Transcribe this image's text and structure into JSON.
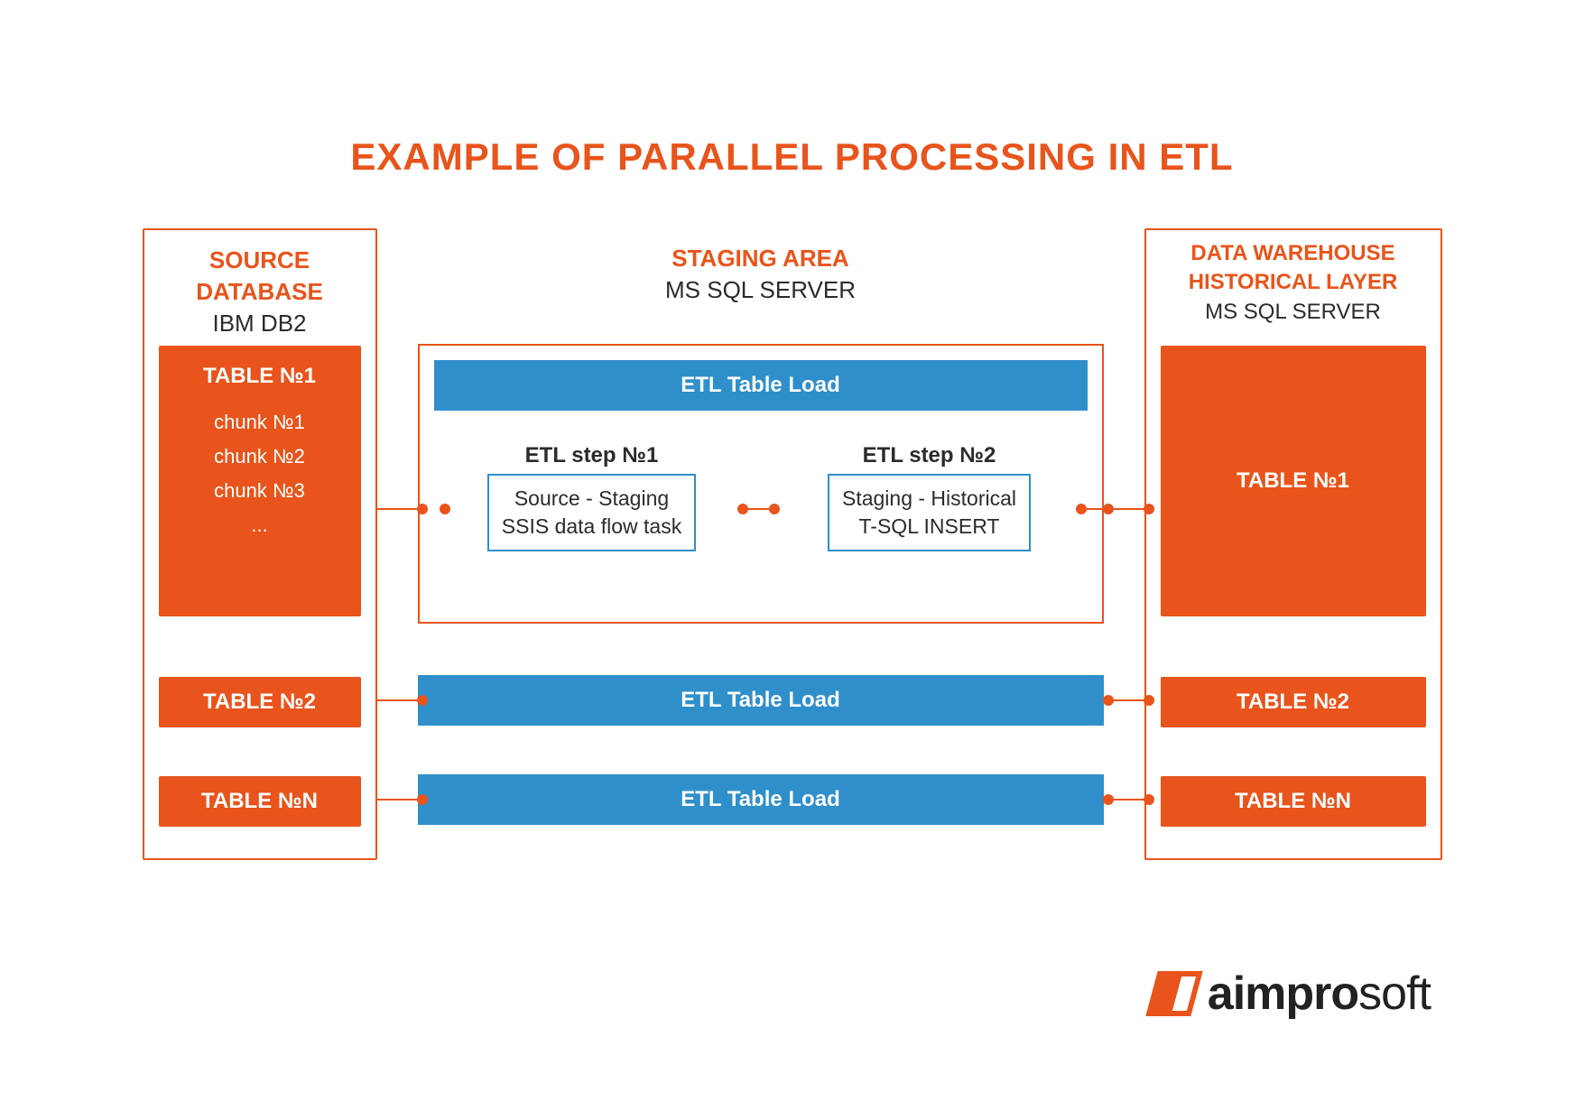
{
  "title": "EXAMPLE OF PARALLEL PROCESSING IN ETL",
  "source": {
    "heading": "SOURCE DATABASE",
    "sub": "IBM DB2",
    "table1": "TABLE №1",
    "chunks": [
      "chunk №1",
      "chunk №2",
      "chunk №3",
      "..."
    ],
    "table2": "TABLE №2",
    "tableN": "TABLE №N"
  },
  "staging": {
    "heading": "STAGING AREA",
    "sub": "MS SQL SERVER",
    "load1": "ETL Table Load",
    "load2": "ETL Table Load",
    "loadN": "ETL Table Load",
    "step1": {
      "title": "ETL step №1",
      "line1": "Source - Staging",
      "line2": "SSIS data flow task"
    },
    "step2": {
      "title": "ETL step №2",
      "line1": "Staging - Historical",
      "line2": "T-SQL INSERT"
    }
  },
  "warehouse": {
    "heading": "DATA WAREHOUSE HISTORICAL LAYER",
    "sub": "MS SQL SERVER",
    "table1": "TABLE №1",
    "table2": "TABLE №2",
    "tableN": "TABLE №N"
  },
  "logo": {
    "bold": "aimpro",
    "rest": "soft"
  }
}
